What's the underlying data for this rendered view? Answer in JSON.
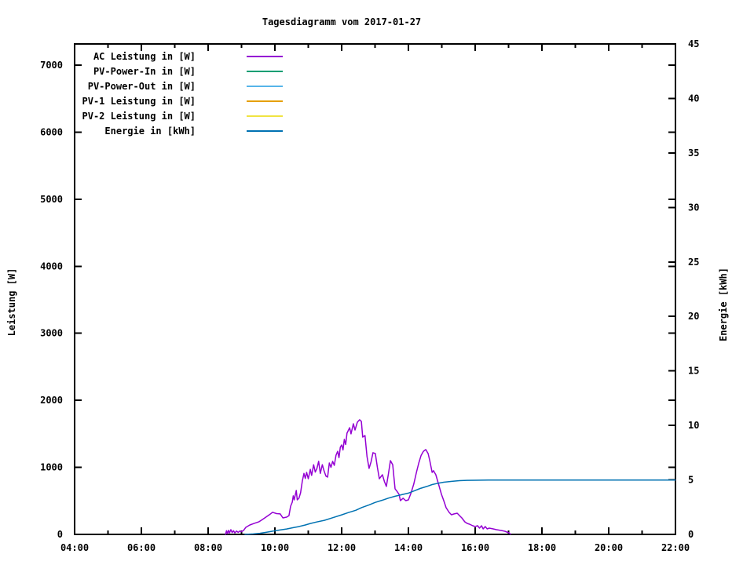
{
  "chart_data": {
    "type": "line",
    "title": "Tagesdiagramm vom 2017-01-27",
    "background": "#ffffff",
    "grid": false,
    "legend": {
      "position": "top-left-inside",
      "entries": [
        {
          "label": "AC Leistung in [W]",
          "color": "#9400d3"
        },
        {
          "label": "PV-Power-In in [W]",
          "color": "#009e73"
        },
        {
          "label": "PV-Power-Out in [W]",
          "color": "#56b4e9"
        },
        {
          "label": "PV-1 Leistung in [W]",
          "color": "#e69f00"
        },
        {
          "label": "PV-2 Leistung in [W]",
          "color": "#f0e442"
        },
        {
          "label": "Energie in [kWh]",
          "color": "#0072b2"
        }
      ]
    },
    "x_axis": {
      "range_hours": [
        4,
        22
      ],
      "major_ticks": [
        {
          "value": 4,
          "label": "04:00"
        },
        {
          "value": 6,
          "label": "06:00"
        },
        {
          "value": 8,
          "label": "08:00"
        },
        {
          "value": 10,
          "label": "10:00"
        },
        {
          "value": 12,
          "label": "12:00"
        },
        {
          "value": 14,
          "label": "14:00"
        },
        {
          "value": 16,
          "label": "16:00"
        },
        {
          "value": 18,
          "label": "18:00"
        },
        {
          "value": 20,
          "label": "20:00"
        },
        {
          "value": 22,
          "label": "22:00"
        }
      ],
      "minor_tick_values": [
        5,
        7,
        9,
        11,
        13,
        15,
        17,
        19,
        21
      ]
    },
    "y_axis_left": {
      "title": "Leistung [W]",
      "range": [
        0,
        7320
      ],
      "tick_values": [
        0,
        1000,
        2000,
        3000,
        4000,
        5000,
        6000,
        7000
      ]
    },
    "y_axis_right": {
      "title": "Energie [kWh]",
      "range": [
        0,
        45
      ],
      "tick_values": [
        0,
        5,
        10,
        15,
        20,
        25,
        30,
        35,
        40,
        45
      ]
    },
    "series": [
      {
        "name": "AC Leistung in [W]",
        "color": "#9400d3",
        "axis": "left",
        "points": [
          [
            8.52,
            0
          ],
          [
            8.55,
            55
          ],
          [
            8.58,
            12
          ],
          [
            8.61,
            60
          ],
          [
            8.64,
            22
          ],
          [
            8.68,
            70
          ],
          [
            8.72,
            28
          ],
          [
            8.76,
            55
          ],
          [
            8.8,
            22
          ],
          [
            8.85,
            50
          ],
          [
            8.9,
            30
          ],
          [
            8.95,
            50
          ],
          [
            9.0,
            40
          ],
          [
            9.06,
            60
          ],
          [
            9.13,
            105
          ],
          [
            9.25,
            140
          ],
          [
            9.38,
            165
          ],
          [
            9.53,
            190
          ],
          [
            9.68,
            240
          ],
          [
            9.84,
            295
          ],
          [
            9.93,
            330
          ],
          [
            10.05,
            310
          ],
          [
            10.16,
            305
          ],
          [
            10.24,
            246
          ],
          [
            10.35,
            258
          ],
          [
            10.42,
            280
          ],
          [
            10.47,
            420
          ],
          [
            10.52,
            480
          ],
          [
            10.55,
            575
          ],
          [
            10.58,
            515
          ],
          [
            10.64,
            655
          ],
          [
            10.67,
            515
          ],
          [
            10.72,
            540
          ],
          [
            10.77,
            620
          ],
          [
            10.82,
            795
          ],
          [
            10.87,
            910
          ],
          [
            10.91,
            835
          ],
          [
            10.95,
            925
          ],
          [
            11.0,
            830
          ],
          [
            11.06,
            970
          ],
          [
            11.1,
            880
          ],
          [
            11.16,
            1040
          ],
          [
            11.21,
            930
          ],
          [
            11.26,
            985
          ],
          [
            11.31,
            1090
          ],
          [
            11.36,
            910
          ],
          [
            11.42,
            1040
          ],
          [
            11.47,
            950
          ],
          [
            11.53,
            870
          ],
          [
            11.58,
            855
          ],
          [
            11.63,
            1065
          ],
          [
            11.68,
            1000
          ],
          [
            11.73,
            1090
          ],
          [
            11.78,
            1030
          ],
          [
            11.83,
            1180
          ],
          [
            11.88,
            1240
          ],
          [
            11.92,
            1145
          ],
          [
            11.96,
            1300
          ],
          [
            12.0,
            1335
          ],
          [
            12.04,
            1260
          ],
          [
            12.08,
            1417
          ],
          [
            12.12,
            1340
          ],
          [
            12.16,
            1510
          ],
          [
            12.24,
            1592
          ],
          [
            12.28,
            1499
          ],
          [
            12.35,
            1651
          ],
          [
            12.4,
            1557
          ],
          [
            12.47,
            1674
          ],
          [
            12.54,
            1710
          ],
          [
            12.59,
            1686
          ],
          [
            12.63,
            1452
          ],
          [
            12.7,
            1475
          ],
          [
            12.76,
            1160
          ],
          [
            12.82,
            985
          ],
          [
            12.88,
            1080
          ],
          [
            12.94,
            1218
          ],
          [
            13.01,
            1206
          ],
          [
            13.07,
            1000
          ],
          [
            13.13,
            830
          ],
          [
            13.22,
            890
          ],
          [
            13.28,
            790
          ],
          [
            13.34,
            715
          ],
          [
            13.4,
            900
          ],
          [
            13.46,
            1100
          ],
          [
            13.53,
            1040
          ],
          [
            13.6,
            680
          ],
          [
            13.66,
            640
          ],
          [
            13.72,
            597
          ],
          [
            13.76,
            503
          ],
          [
            13.84,
            540
          ],
          [
            13.92,
            503
          ],
          [
            14.0,
            515
          ],
          [
            14.08,
            620
          ],
          [
            14.16,
            750
          ],
          [
            14.24,
            925
          ],
          [
            14.31,
            1065
          ],
          [
            14.38,
            1180
          ],
          [
            14.45,
            1240
          ],
          [
            14.52,
            1265
          ],
          [
            14.59,
            1206
          ],
          [
            14.64,
            1100
          ],
          [
            14.71,
            925
          ],
          [
            14.75,
            950
          ],
          [
            14.82,
            890
          ],
          [
            14.89,
            773
          ],
          [
            14.99,
            597
          ],
          [
            15.06,
            503
          ],
          [
            15.13,
            398
          ],
          [
            15.22,
            328
          ],
          [
            15.29,
            293
          ],
          [
            15.36,
            304
          ],
          [
            15.46,
            316
          ],
          [
            15.53,
            281
          ],
          [
            15.6,
            246
          ],
          [
            15.69,
            187
          ],
          [
            15.76,
            164
          ],
          [
            15.83,
            152
          ],
          [
            15.93,
            129
          ],
          [
            16.0,
            117
          ],
          [
            16.07,
            130
          ],
          [
            16.13,
            94
          ],
          [
            16.19,
            129
          ],
          [
            16.24,
            82
          ],
          [
            16.3,
            117
          ],
          [
            16.36,
            82
          ],
          [
            16.42,
            94
          ],
          [
            16.54,
            82
          ],
          [
            16.64,
            70
          ],
          [
            16.78,
            59
          ],
          [
            16.89,
            47
          ],
          [
            17.01,
            23
          ],
          [
            17.06,
            5
          ]
        ]
      },
      {
        "name": "PV-Power-In in [W]",
        "color": "#009e73",
        "axis": "left",
        "points": []
      },
      {
        "name": "PV-Power-Out in [W]",
        "color": "#56b4e9",
        "axis": "left",
        "points": []
      },
      {
        "name": "PV-1 Leistung in [W]",
        "color": "#e69f00",
        "axis": "left",
        "points": []
      },
      {
        "name": "PV-2 Leistung in [W]",
        "color": "#f0e442",
        "axis": "left",
        "points": []
      },
      {
        "name": "Energie in [kWh]",
        "color": "#0072b2",
        "axis": "right",
        "points": [
          [
            9.1,
            0
          ],
          [
            9.35,
            0.04
          ],
          [
            9.55,
            0.1
          ],
          [
            9.75,
            0.2
          ],
          [
            9.95,
            0.3
          ],
          [
            10.15,
            0.4
          ],
          [
            10.35,
            0.5
          ],
          [
            10.55,
            0.62
          ],
          [
            10.71,
            0.71
          ],
          [
            10.9,
            0.86
          ],
          [
            11.06,
            1.0
          ],
          [
            11.25,
            1.14
          ],
          [
            11.48,
            1.29
          ],
          [
            11.7,
            1.5
          ],
          [
            12.0,
            1.79
          ],
          [
            12.2,
            2.0
          ],
          [
            12.42,
            2.21
          ],
          [
            12.6,
            2.46
          ],
          [
            12.82,
            2.71
          ],
          [
            13.0,
            2.93
          ],
          [
            13.22,
            3.14
          ],
          [
            13.4,
            3.33
          ],
          [
            13.6,
            3.5
          ],
          [
            13.8,
            3.64
          ],
          [
            14.0,
            3.79
          ],
          [
            14.18,
            4.0
          ],
          [
            14.35,
            4.21
          ],
          [
            14.55,
            4.4
          ],
          [
            14.71,
            4.57
          ],
          [
            14.9,
            4.7
          ],
          [
            15.06,
            4.79
          ],
          [
            15.3,
            4.87
          ],
          [
            15.53,
            4.93
          ],
          [
            15.75,
            4.96
          ],
          [
            16.0,
            4.97
          ],
          [
            16.4,
            4.98
          ],
          [
            17.0,
            4.98
          ],
          [
            18.0,
            4.98
          ],
          [
            20.0,
            4.98
          ],
          [
            22.0,
            4.98
          ]
        ]
      }
    ]
  }
}
